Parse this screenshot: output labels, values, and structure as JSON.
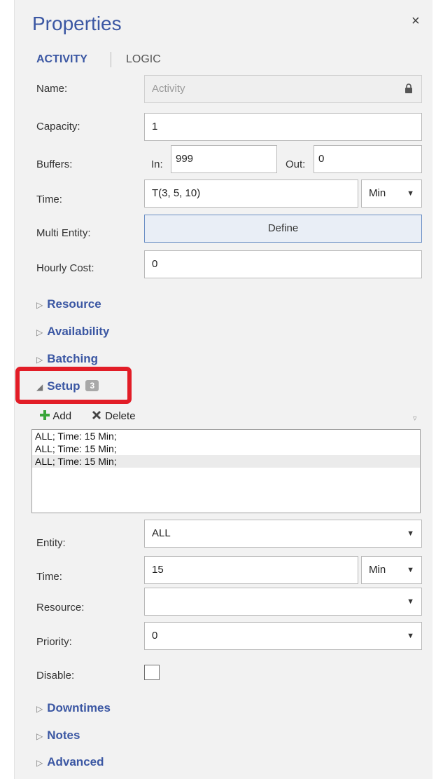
{
  "panel": {
    "title": "Properties",
    "close": "×"
  },
  "tabs": {
    "activity": "ACTIVITY",
    "logic": "LOGIC"
  },
  "fields": {
    "name_label": "Name:",
    "name_placeholder": "Activity",
    "capacity_label": "Capacity:",
    "capacity_value": "1",
    "buffers_label": "Buffers:",
    "in_label": "In:",
    "in_value": "999",
    "out_label": "Out:",
    "out_value": "0",
    "time_label": "Time:",
    "time_value": "T(3, 5, 10)",
    "time_unit": "Min",
    "multi_entity_label": "Multi Entity:",
    "define_button": "Define",
    "hourly_cost_label": "Hourly Cost:",
    "hourly_cost_value": "0"
  },
  "sections": {
    "resource": "Resource",
    "availability": "Availability",
    "batching": "Batching",
    "setup": "Setup",
    "setup_count": "3",
    "downtimes": "Downtimes",
    "notes": "Notes",
    "advanced": "Advanced"
  },
  "setup": {
    "add_label": "Add",
    "delete_label": "Delete",
    "items": [
      "ALL; Time: 15 Min;",
      "ALL; Time: 15 Min;",
      "ALL; Time: 15 Min;"
    ],
    "entity_label": "Entity:",
    "entity_value": "ALL",
    "time_label": "Time:",
    "time_value": "15",
    "time_unit": "Min",
    "resource_label": "Resource:",
    "resource_value": "",
    "priority_label": "Priority:",
    "priority_value": "0",
    "disable_label": "Disable:"
  },
  "colors": {
    "accent": "#3b57a3",
    "highlight": "#e21d27",
    "add_icon": "#3aa63a"
  }
}
